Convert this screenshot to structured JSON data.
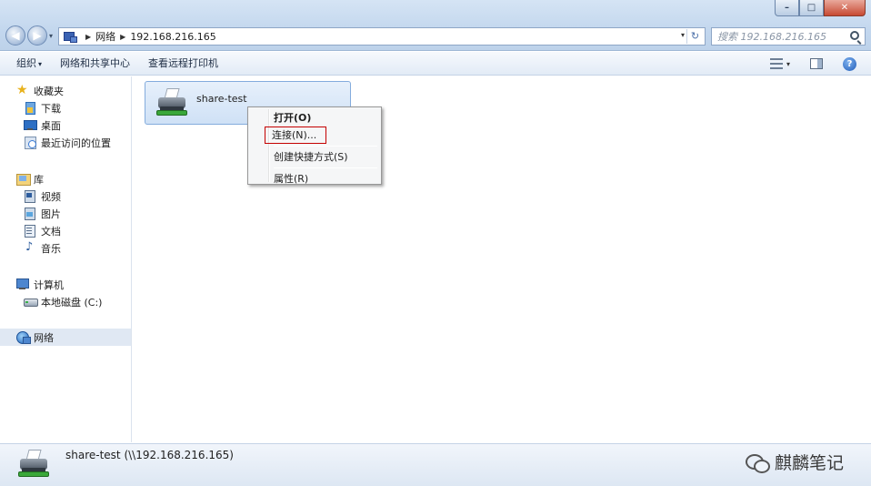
{
  "window": {
    "minimize_label": "–",
    "maximize_label": "□",
    "close_label": "✕"
  },
  "nav": {
    "back_label": "◀",
    "forward_label": "▶",
    "dropdown_label": "▾"
  },
  "address": {
    "crumbs": [
      "网络",
      "192.168.216.165"
    ],
    "dropdown_label": "▾",
    "refresh_label": "↻"
  },
  "search": {
    "placeholder": "搜索 192.168.216.165"
  },
  "toolbar": {
    "organize_label": "组织",
    "network_sharing_label": "网络和共享中心",
    "remote_printers_label": "查看远程打印机"
  },
  "sidebar": {
    "favorites": {
      "label": "收藏夹",
      "items": [
        "下载",
        "桌面",
        "最近访问的位置"
      ]
    },
    "libraries": {
      "label": "库",
      "items": [
        "视频",
        "图片",
        "文档",
        "音乐"
      ]
    },
    "computer": {
      "label": "计算机",
      "items": [
        "本地磁盘 (C:)"
      ]
    },
    "network": {
      "label": "网络"
    }
  },
  "content": {
    "items": [
      {
        "name": "share-test",
        "icon": "network-printer-icon"
      }
    ]
  },
  "context_menu": {
    "items": [
      {
        "label": "打开(O)",
        "bold": true
      },
      {
        "label": "连接(N)...",
        "highlighted": true
      },
      {
        "label": "创建快捷方式(S)"
      },
      {
        "label": "属性(R)"
      }
    ],
    "highlight_color": "#c40000"
  },
  "details": {
    "text": "share-test (\\\\192.168.216.165)"
  },
  "watermark": {
    "text": "麒麟笔记"
  }
}
